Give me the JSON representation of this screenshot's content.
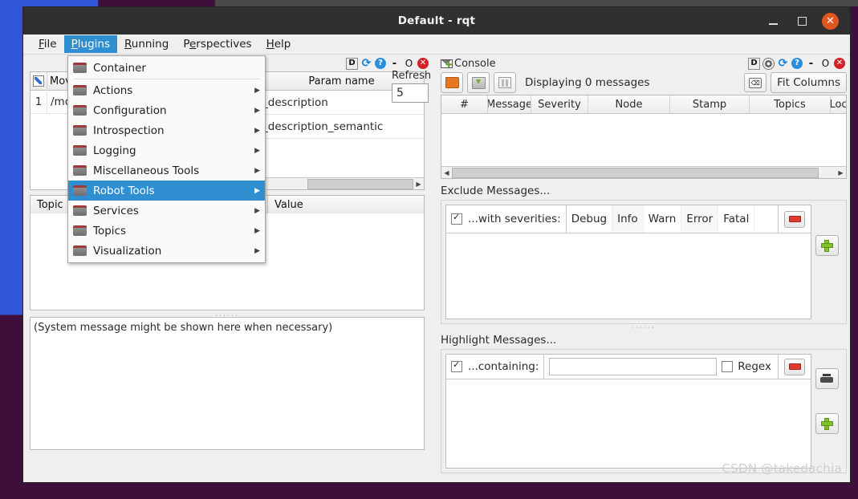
{
  "window": {
    "title": "Default - rqt",
    "controls": {
      "minimize": "–",
      "maximize": "□",
      "close": "✕"
    }
  },
  "menubar": [
    {
      "label": "File",
      "mnemonic": "F"
    },
    {
      "label": "Plugins",
      "mnemonic": "P",
      "active": true
    },
    {
      "label": "Running",
      "mnemonic": "R"
    },
    {
      "label": "Perspectives",
      "mnemonic": "e"
    },
    {
      "label": "Help",
      "mnemonic": "H"
    }
  ],
  "plugins_menu": {
    "items": [
      {
        "label": "Container",
        "submenu": false,
        "selected": false
      },
      {
        "label": "Actions",
        "submenu": true,
        "selected": false
      },
      {
        "label": "Configuration",
        "submenu": true,
        "selected": false
      },
      {
        "label": "Introspection",
        "submenu": true,
        "selected": false
      },
      {
        "label": "Logging",
        "submenu": true,
        "selected": false
      },
      {
        "label": "Miscellaneous Tools",
        "submenu": true,
        "selected": false
      },
      {
        "label": "Robot Tools",
        "submenu": true,
        "selected": true
      },
      {
        "label": "Services",
        "submenu": true,
        "selected": false
      },
      {
        "label": "Topics",
        "submenu": true,
        "selected": false
      },
      {
        "label": "Visualization",
        "submenu": true,
        "selected": false
      }
    ],
    "submenu_arrow": "▶",
    "folder_icon": "folder-icon"
  },
  "param_panel": {
    "titlebar_icons": [
      "D",
      "reload-icon",
      "help-icon",
      "dash-icon",
      "float-icon",
      "close-icon"
    ],
    "icon_labels": {
      "d": "D",
      "reload": "⟳",
      "help": "?",
      "dash": "-",
      "float": "O",
      "close": "✕"
    },
    "node_header": "Mov",
    "node_row_index": "1",
    "node_row_value": "/mo",
    "param_header": "Param name",
    "param_rows": [
      "_description",
      "_description_semantic"
    ],
    "refresh_label": "Refresh",
    "refresh_value": "5"
  },
  "topic_panel": {
    "headers": [
      "Topic",
      "Value"
    ]
  },
  "system_panel": {
    "message": "(System message might be shown here when necessary)"
  },
  "console": {
    "title": "Console",
    "titlebar_icons": [
      "D",
      "settings-icon",
      "reload-icon",
      "help-icon",
      "dash-icon",
      "float-icon",
      "close-icon"
    ],
    "icon_labels": {
      "d": "D",
      "reload": "⟳",
      "help": "?",
      "dash": "-",
      "float": "O",
      "close": "✕"
    },
    "toolbar": {
      "open_icon": "open-file-icon",
      "save_icon": "save-icon",
      "pause_icon": "pause-icon",
      "status": "Displaying 0 messages",
      "clear_icon": "clear-icon",
      "fit_columns": "Fit Columns"
    },
    "table": {
      "columns": [
        "#",
        "Message",
        "Severity",
        "Node",
        "Stamp",
        "Topics",
        "Loc"
      ],
      "rows": []
    },
    "exclude": {
      "section_label": "Exclude Messages...",
      "checkbox_checked": true,
      "row_label": "...with severities:",
      "severities": [
        "Debug",
        "Info",
        "Warn",
        "Error",
        "Fatal"
      ],
      "remove_icon": "minus-icon",
      "add_icon": "plus-icon"
    },
    "highlight": {
      "section_label": "Highlight Messages...",
      "checkbox_checked": true,
      "row_label": "...containing:",
      "input_value": "",
      "regex_label": "Regex",
      "regex_checked": false,
      "remove_icon": "minus-icon",
      "print_icon": "printer-icon",
      "add_icon": "plus-icon"
    }
  },
  "watermark": "CSDN @takedachia",
  "colors": {
    "titlebar_bg": "#303030",
    "close_btn": "#e0561f",
    "menu_highlight": "#2f8fd0",
    "panel_bg": "#efefef",
    "desktop_blue": "#2f57d8",
    "desktop_purple": "#3d0f3a",
    "error_red": "#d42027"
  }
}
